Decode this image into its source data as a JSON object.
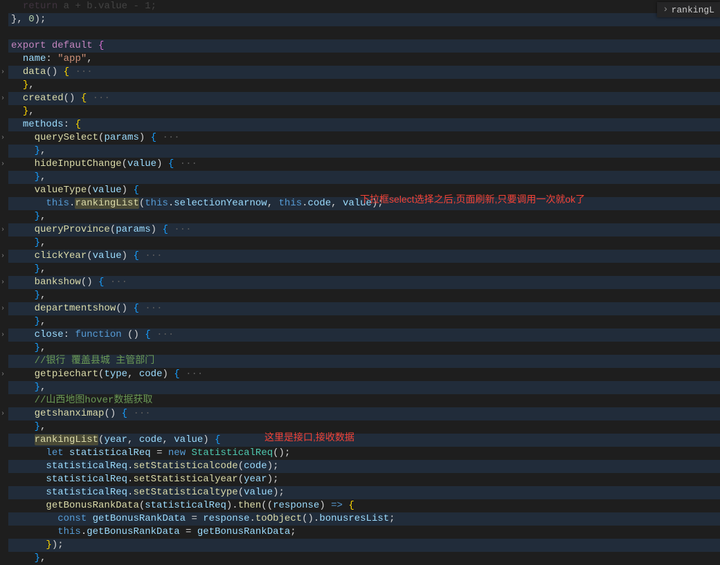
{
  "breadcrumb": {
    "item": "rankingL"
  },
  "annot1": "下拉框select选择之后,页面刷新,只要调用一次就ok了",
  "annot2": "这里是接口,接收数据",
  "lines": [
    {
      "hl": false,
      "i": 0
    },
    {
      "hl": true,
      "tokens": [
        [
          "punc",
          "}, "
        ],
        [
          "num",
          "0"
        ],
        [
          "punc",
          ");"
        ]
      ]
    },
    {
      "hl": false,
      "tokens": []
    },
    {
      "hl": true,
      "tokens": [
        [
          "k-export",
          "export"
        ],
        [
          "punc",
          " "
        ],
        [
          "k-default",
          "default"
        ],
        [
          "punc",
          " "
        ],
        [
          "brace",
          "{"
        ]
      ]
    },
    {
      "hl": false,
      "tokens": [
        [
          "punc",
          "  "
        ],
        [
          "prop",
          "name"
        ],
        [
          "punc",
          ": "
        ],
        [
          "str",
          "\"app\""
        ],
        [
          "punc",
          ","
        ]
      ]
    },
    {
      "hl": true,
      "fold": true,
      "tokens": [
        [
          "punc",
          "  "
        ],
        [
          "fn",
          "data"
        ],
        [
          "punc",
          "() "
        ],
        [
          "brace-b",
          "{"
        ],
        [
          "dots",
          " ···"
        ]
      ]
    },
    {
      "hl": false,
      "tokens": [
        [
          "punc",
          "  "
        ],
        [
          "brace-b",
          "}"
        ],
        [
          "punc",
          ","
        ]
      ]
    },
    {
      "hl": true,
      "fold": true,
      "tokens": [
        [
          "punc",
          "  "
        ],
        [
          "fn",
          "created"
        ],
        [
          "punc",
          "() "
        ],
        [
          "brace-b",
          "{"
        ],
        [
          "dots",
          " ···"
        ]
      ]
    },
    {
      "hl": false,
      "tokens": [
        [
          "punc",
          "  "
        ],
        [
          "brace-b",
          "}"
        ],
        [
          "punc",
          ","
        ]
      ]
    },
    {
      "hl": true,
      "tokens": [
        [
          "punc",
          "  "
        ],
        [
          "prop",
          "methods"
        ],
        [
          "punc",
          ": "
        ],
        [
          "brace-b",
          "{"
        ]
      ]
    },
    {
      "hl": false,
      "fold": true,
      "tokens": [
        [
          "punc",
          "    "
        ],
        [
          "fn",
          "querySelect"
        ],
        [
          "punc",
          "("
        ],
        [
          "param",
          "params"
        ],
        [
          "punc",
          ") "
        ],
        [
          "paren-b",
          "{"
        ],
        [
          "dots",
          " ···"
        ]
      ]
    },
    {
      "hl": true,
      "tokens": [
        [
          "punc",
          "    "
        ],
        [
          "paren-b",
          "}"
        ],
        [
          "punc",
          ","
        ]
      ]
    },
    {
      "hl": false,
      "fold": true,
      "tokens": [
        [
          "punc",
          "    "
        ],
        [
          "fn",
          "hideInputChange"
        ],
        [
          "punc",
          "("
        ],
        [
          "param",
          "value"
        ],
        [
          "punc",
          ") "
        ],
        [
          "paren-b",
          "{"
        ],
        [
          "dots",
          " ···"
        ]
      ]
    },
    {
      "hl": true,
      "tokens": [
        [
          "punc",
          "    "
        ],
        [
          "paren-b",
          "}"
        ],
        [
          "punc",
          ","
        ]
      ]
    },
    {
      "hl": false,
      "tokens": [
        [
          "punc",
          "    "
        ],
        [
          "fn",
          "valueType"
        ],
        [
          "punc",
          "("
        ],
        [
          "param",
          "value"
        ],
        [
          "punc",
          ") "
        ],
        [
          "paren-b",
          "{"
        ]
      ]
    },
    {
      "hl": true,
      "tokens": [
        [
          "punc",
          "      "
        ],
        [
          "k-this",
          "this"
        ],
        [
          "punc",
          "."
        ],
        [
          "fn-hl",
          "rankingList"
        ],
        [
          "punc",
          "("
        ],
        [
          "k-this",
          "this"
        ],
        [
          "punc",
          "."
        ],
        [
          "prop",
          "selectionYearnow"
        ],
        [
          "punc",
          ", "
        ],
        [
          "k-this",
          "this"
        ],
        [
          "punc",
          "."
        ],
        [
          "prop",
          "code"
        ],
        [
          "punc",
          ", "
        ],
        [
          "param",
          "value"
        ],
        [
          "punc",
          ");"
        ]
      ]
    },
    {
      "hl": false,
      "tokens": [
        [
          "punc",
          "    "
        ],
        [
          "paren-b",
          "}"
        ],
        [
          "punc",
          ","
        ]
      ]
    },
    {
      "hl": true,
      "fold": true,
      "tokens": [
        [
          "punc",
          "    "
        ],
        [
          "fn",
          "queryProvince"
        ],
        [
          "punc",
          "("
        ],
        [
          "param",
          "params"
        ],
        [
          "punc",
          ") "
        ],
        [
          "paren-b",
          "{"
        ],
        [
          "dots",
          " ···"
        ]
      ]
    },
    {
      "hl": false,
      "tokens": [
        [
          "punc",
          "    "
        ],
        [
          "paren-b",
          "}"
        ],
        [
          "punc",
          ","
        ]
      ]
    },
    {
      "hl": true,
      "fold": true,
      "tokens": [
        [
          "punc",
          "    "
        ],
        [
          "fn",
          "clickYear"
        ],
        [
          "punc",
          "("
        ],
        [
          "param",
          "value"
        ],
        [
          "punc",
          ") "
        ],
        [
          "paren-b",
          "{"
        ],
        [
          "dots",
          " ···"
        ]
      ]
    },
    {
      "hl": false,
      "tokens": [
        [
          "punc",
          "    "
        ],
        [
          "paren-b",
          "}"
        ],
        [
          "punc",
          ","
        ]
      ]
    },
    {
      "hl": true,
      "fold": true,
      "tokens": [
        [
          "punc",
          "    "
        ],
        [
          "fn",
          "bankshow"
        ],
        [
          "punc",
          "() "
        ],
        [
          "paren-b",
          "{"
        ],
        [
          "dots",
          " ···"
        ]
      ]
    },
    {
      "hl": false,
      "tokens": [
        [
          "punc",
          "    "
        ],
        [
          "paren-b",
          "}"
        ],
        [
          "punc",
          ","
        ]
      ]
    },
    {
      "hl": true,
      "fold": true,
      "tokens": [
        [
          "punc",
          "    "
        ],
        [
          "fn",
          "departmentshow"
        ],
        [
          "punc",
          "() "
        ],
        [
          "paren-b",
          "{"
        ],
        [
          "dots",
          " ···"
        ]
      ]
    },
    {
      "hl": false,
      "tokens": [
        [
          "punc",
          "    "
        ],
        [
          "paren-b",
          "}"
        ],
        [
          "punc",
          ","
        ]
      ]
    },
    {
      "hl": true,
      "fold": true,
      "tokens": [
        [
          "punc",
          "    "
        ],
        [
          "prop",
          "close"
        ],
        [
          "punc",
          ": "
        ],
        [
          "k-function",
          "function"
        ],
        [
          "punc",
          " () "
        ],
        [
          "paren-b",
          "{"
        ],
        [
          "dots",
          " ···"
        ]
      ]
    },
    {
      "hl": false,
      "tokens": [
        [
          "punc",
          "    "
        ],
        [
          "paren-b",
          "}"
        ],
        [
          "punc",
          ","
        ]
      ]
    },
    {
      "hl": true,
      "tokens": [
        [
          "punc",
          "    "
        ],
        [
          "comment",
          "//银行 覆盖县城 主管部门"
        ]
      ]
    },
    {
      "hl": false,
      "fold": true,
      "tokens": [
        [
          "punc",
          "    "
        ],
        [
          "fn",
          "getpiechart"
        ],
        [
          "punc",
          "("
        ],
        [
          "param",
          "type"
        ],
        [
          "punc",
          ", "
        ],
        [
          "param",
          "code"
        ],
        [
          "punc",
          ") "
        ],
        [
          "paren-b",
          "{"
        ],
        [
          "dots",
          " ···"
        ]
      ]
    },
    {
      "hl": true,
      "tokens": [
        [
          "punc",
          "    "
        ],
        [
          "paren-b",
          "}"
        ],
        [
          "punc",
          ","
        ]
      ]
    },
    {
      "hl": false,
      "tokens": [
        [
          "punc",
          "    "
        ],
        [
          "comment",
          "//山西地图hover数据获取"
        ]
      ]
    },
    {
      "hl": true,
      "fold": true,
      "tokens": [
        [
          "punc",
          "    "
        ],
        [
          "fn",
          "getshanximap"
        ],
        [
          "punc",
          "() "
        ],
        [
          "paren-b",
          "{"
        ],
        [
          "dots",
          " ···"
        ]
      ]
    },
    {
      "hl": false,
      "tokens": [
        [
          "punc",
          "    "
        ],
        [
          "paren-b",
          "}"
        ],
        [
          "punc",
          ","
        ]
      ]
    },
    {
      "hl": true,
      "tokens": [
        [
          "punc",
          "    "
        ],
        [
          "fn-hl",
          "rankingList"
        ],
        [
          "punc",
          "("
        ],
        [
          "param",
          "year"
        ],
        [
          "punc",
          ", "
        ],
        [
          "param",
          "code"
        ],
        [
          "punc",
          ", "
        ],
        [
          "param",
          "value"
        ],
        [
          "punc",
          ") "
        ],
        [
          "paren-b",
          "{"
        ]
      ]
    },
    {
      "hl": false,
      "tokens": [
        [
          "punc",
          "      "
        ],
        [
          "k-let",
          "let"
        ],
        [
          "punc",
          " "
        ],
        [
          "prop",
          "statisticalReq"
        ],
        [
          "punc",
          " = "
        ],
        [
          "k-new",
          "new"
        ],
        [
          "punc",
          " "
        ],
        [
          "cls",
          "StatisticalReq"
        ],
        [
          "punc",
          "();"
        ]
      ]
    },
    {
      "hl": true,
      "tokens": [
        [
          "punc",
          "      "
        ],
        [
          "prop",
          "statisticalReq"
        ],
        [
          "punc",
          "."
        ],
        [
          "fn",
          "setStatisticalcode"
        ],
        [
          "punc",
          "("
        ],
        [
          "param",
          "code"
        ],
        [
          "punc",
          ");"
        ]
      ]
    },
    {
      "hl": false,
      "tokens": [
        [
          "punc",
          "      "
        ],
        [
          "prop",
          "statisticalReq"
        ],
        [
          "punc",
          "."
        ],
        [
          "fn",
          "setStatisticalyear"
        ],
        [
          "punc",
          "("
        ],
        [
          "param",
          "year"
        ],
        [
          "punc",
          ");"
        ]
      ]
    },
    {
      "hl": true,
      "tokens": [
        [
          "punc",
          "      "
        ],
        [
          "prop",
          "statisticalReq"
        ],
        [
          "punc",
          "."
        ],
        [
          "fn",
          "setStatisticaltype"
        ],
        [
          "punc",
          "("
        ],
        [
          "param",
          "value"
        ],
        [
          "punc",
          ");"
        ]
      ]
    },
    {
      "hl": false,
      "tokens": [
        [
          "punc",
          "      "
        ],
        [
          "fn",
          "getBonusRankData"
        ],
        [
          "punc",
          "("
        ],
        [
          "prop",
          "statisticalReq"
        ],
        [
          "punc",
          ")."
        ],
        [
          "fn",
          "then"
        ],
        [
          "punc",
          "(("
        ],
        [
          "param",
          "response"
        ],
        [
          "punc",
          ") "
        ],
        [
          "k-function",
          "=>"
        ],
        [
          "punc",
          " "
        ],
        [
          "brace-b",
          "{"
        ]
      ]
    },
    {
      "hl": true,
      "tokens": [
        [
          "punc",
          "        "
        ],
        [
          "k-const",
          "const"
        ],
        [
          "punc",
          " "
        ],
        [
          "prop",
          "getBonusRankData"
        ],
        [
          "punc",
          " = "
        ],
        [
          "prop",
          "response"
        ],
        [
          "punc",
          "."
        ],
        [
          "fn",
          "toObject"
        ],
        [
          "punc",
          "()."
        ],
        [
          "prop",
          "bonusresList"
        ],
        [
          "punc",
          ";"
        ]
      ]
    },
    {
      "hl": false,
      "tokens": [
        [
          "punc",
          "        "
        ],
        [
          "k-this",
          "this"
        ],
        [
          "punc",
          "."
        ],
        [
          "prop",
          "getBonusRankData"
        ],
        [
          "punc",
          " = "
        ],
        [
          "prop",
          "getBonusRankData"
        ],
        [
          "punc",
          ";"
        ]
      ]
    },
    {
      "hl": true,
      "tokens": [
        [
          "punc",
          "      "
        ],
        [
          "brace-b",
          "}"
        ],
        [
          "punc",
          ");"
        ]
      ]
    },
    {
      "hl": false,
      "tokens": [
        [
          "punc",
          "    "
        ],
        [
          "paren-b",
          "}"
        ],
        [
          "punc",
          ","
        ]
      ]
    }
  ],
  "foldRows": [
    5,
    7,
    10,
    12,
    17,
    19,
    21,
    23,
    25,
    28,
    31
  ]
}
